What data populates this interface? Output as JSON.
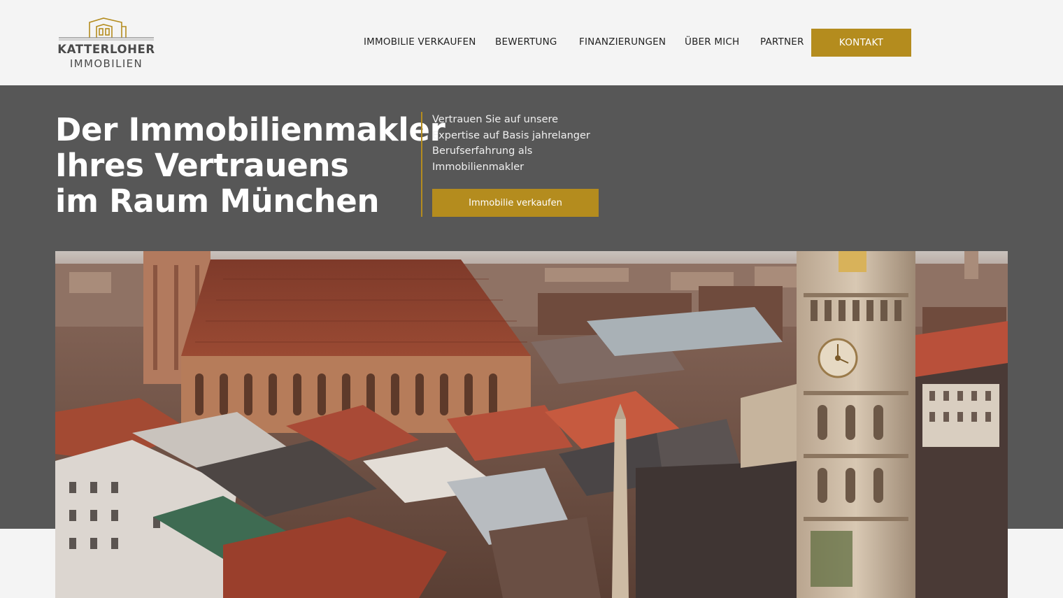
{
  "header": {
    "logo": {
      "line1": "KATTERLOHER",
      "line2": "IMMOBILIEN",
      "icon": "house-outline-icon",
      "accent": "#b48c1e"
    },
    "nav": [
      {
        "label": "IMMOBILIE VERKAUFEN"
      },
      {
        "label": "BEWERTUNG"
      },
      {
        "label": "FINANZIERUNGEN"
      },
      {
        "label": "ÜBER MICH"
      },
      {
        "label": "PARTNER"
      }
    ],
    "cta_label": "KONTAKT"
  },
  "hero": {
    "title_lines": [
      "Der Immobilienmakler",
      "Ihres Vertrauens",
      "im Raum München"
    ],
    "text": "Vertrauen Sie auf unsere Expertise auf Basis jahrelanger Berufserfahrung als Immobilienmakler",
    "cta_label": "Immobilie verkaufen",
    "background": "#575757"
  },
  "image": {
    "subject": "munich-city-aerial-photo"
  },
  "colors": {
    "accent": "#b48c1e",
    "header_bg": "#f4f4f4",
    "hero_bg": "#575757"
  }
}
